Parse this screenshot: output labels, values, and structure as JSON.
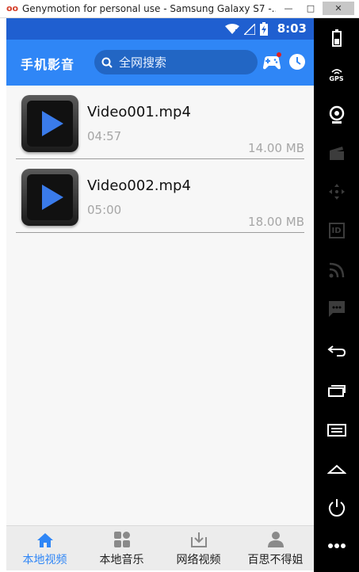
{
  "window": {
    "title": "Genymotion for personal use - Samsung Galaxy S7 -...",
    "logo": "oo",
    "minimize": "—",
    "maximize": "□",
    "close": "✕"
  },
  "statusbar": {
    "time": "8:03",
    "icons": [
      "wifi-icon",
      "no-signal-icon",
      "battery-charging-icon"
    ]
  },
  "appbar": {
    "app_name": "手机影音",
    "search_placeholder": "全网搜索",
    "actions": [
      "game-controller-icon",
      "history-clock-icon"
    ]
  },
  "videos": [
    {
      "name": "Video001.mp4",
      "duration": "04:57",
      "size": "14.00 MB"
    },
    {
      "name": "Video002.mp4",
      "duration": "05:00",
      "size": "18.00 MB"
    }
  ],
  "tabs": [
    {
      "label": "本地视频",
      "icon": "home-icon",
      "active": true
    },
    {
      "label": "本地音乐",
      "icon": "music-grid-icon",
      "active": false
    },
    {
      "label": "网络视频",
      "icon": "download-icon",
      "active": false
    },
    {
      "label": "百思不得姐",
      "icon": "person-icon",
      "active": false
    }
  ],
  "sidebar": {
    "gps_label": "GPS",
    "id_label": "ID",
    "icons": [
      "battery-icon",
      "gps-icon",
      "webcam-icon",
      "clapper-icon",
      "dpad-icon",
      "id-icon",
      "rss-icon",
      "sms-icon",
      "back-icon",
      "recent-apps-icon",
      "menu-icon",
      "home-icon",
      "power-icon",
      "more-icon"
    ]
  },
  "colors": {
    "statusbar": "#1f5fd0",
    "appbar": "#2f86f6",
    "accent": "#2f86f6",
    "notification_dot": "#e02020"
  }
}
